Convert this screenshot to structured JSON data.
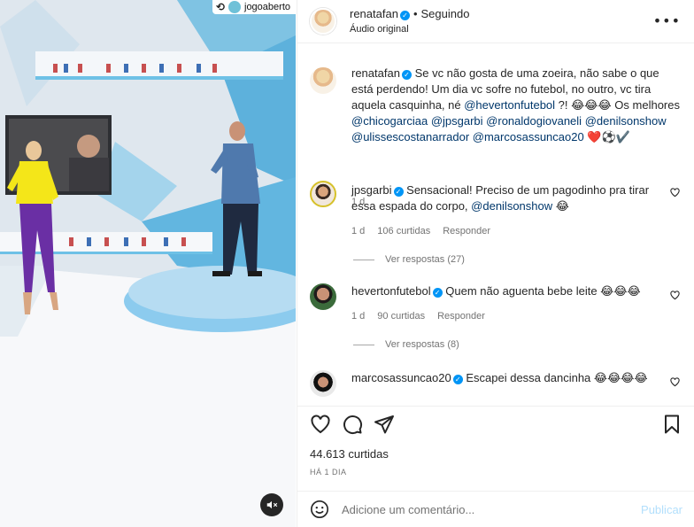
{
  "media": {
    "repost_icon": "repost-icon",
    "repost_username": "jogoaberto",
    "mute_icon": "speaker-muted-icon"
  },
  "header": {
    "username": "renatafan",
    "separator": "•",
    "follow_status": "Seguindo",
    "subtitle": "Áudio original",
    "more_icon": "more-horizontal-icon"
  },
  "caption": {
    "username": "renatafan",
    "text_1": "Se vc não gosta de uma zoeira, não sabe o que está perdendo! Um dia vc sofre no futebol, no outro, vc tira aquela casquinha, né ",
    "mention_1": "@hevertonfutebol",
    "text_2": " ?! 😂😂😂 Os melhores ",
    "mention_2": "@chicogarciaa",
    "mention_3": "@jpsgarbi",
    "mention_4": "@ronaldogiovaneli",
    "mention_5": "@denilsonshow",
    "mention_6": "@ulissescostanarrador",
    "mention_7": "@marcosassuncao20",
    "emoji_tail": "❤️⚽✔️",
    "time": "1 d"
  },
  "comments": [
    {
      "username": "jpsgarbi",
      "text": "Sensacional! Preciso de um pagodinho pra tirar essa espada do corpo, ",
      "mention": "@denilsonshow",
      "emoji": " 😂",
      "time": "1 d",
      "likes": "106 curtidas",
      "reply": "Responder",
      "view_replies": "Ver respostas (27)"
    },
    {
      "username": "hevertonfutebol",
      "text": "Quem não aguenta bebe leite 😂😂😂",
      "time": "1 d",
      "likes": "90 curtidas",
      "reply": "Responder",
      "view_replies": "Ver respostas (8)"
    },
    {
      "username": "marcosassuncao20",
      "text": "Escapei dessa dancinha 😂😂😂😂"
    }
  ],
  "actions": {
    "like_icon": "heart-icon",
    "comment_icon": "comment-icon",
    "share_icon": "share-icon",
    "save_icon": "bookmark-icon",
    "likes": "44.613 curtidas",
    "date": "HÁ 1 DIA"
  },
  "add_comment": {
    "emoji_icon": "smiley-icon",
    "placeholder": "Adicione um comentário...",
    "post_label": "Publicar"
  },
  "colors": {
    "accent": "#0095f6",
    "mention": "#00376b",
    "muted": "#737373",
    "publish_disabled": "#b2dffc"
  }
}
